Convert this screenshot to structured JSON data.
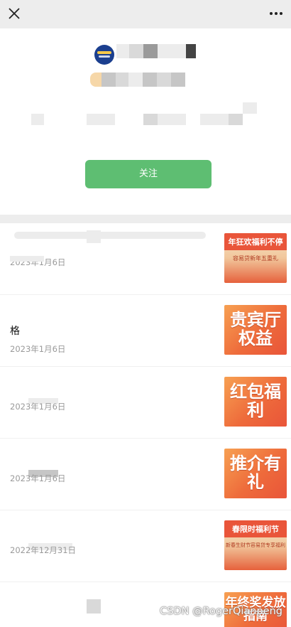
{
  "header": {
    "close_icon": "close-icon",
    "more_icon": "more-icon"
  },
  "profile": {
    "logo_icon": "bank-logo-icon",
    "follow_label": "关注",
    "follow_color": "#5ebe72"
  },
  "articles": [
    {
      "title": "",
      "date": "2023年1月6日",
      "thumb_text": "年狂欢福利不停",
      "thumb_sub": "容易贷新年五重礼"
    },
    {
      "title": "格",
      "date": "2023年1月6日",
      "thumb_text": "贵宾厅权益"
    },
    {
      "title": "",
      "date": "2023年1月6日",
      "thumb_text": "红包福利"
    },
    {
      "title": "",
      "date": "2023年1月6日",
      "thumb_text": "推介有礼"
    },
    {
      "title": "",
      "date": "2022年12月31日",
      "thumb_text": "春限时福利节",
      "thumb_sub": "新春生财节容易贷专享福利"
    },
    {
      "title": "",
      "date": "",
      "thumb_text": "年终奖发放指南"
    }
  ],
  "watermark": "CSDN @RogerQianpeng",
  "colors": {
    "accent": "#5ebe72",
    "thumb_orange": "#ee6b3b",
    "divider": "#ededed"
  }
}
